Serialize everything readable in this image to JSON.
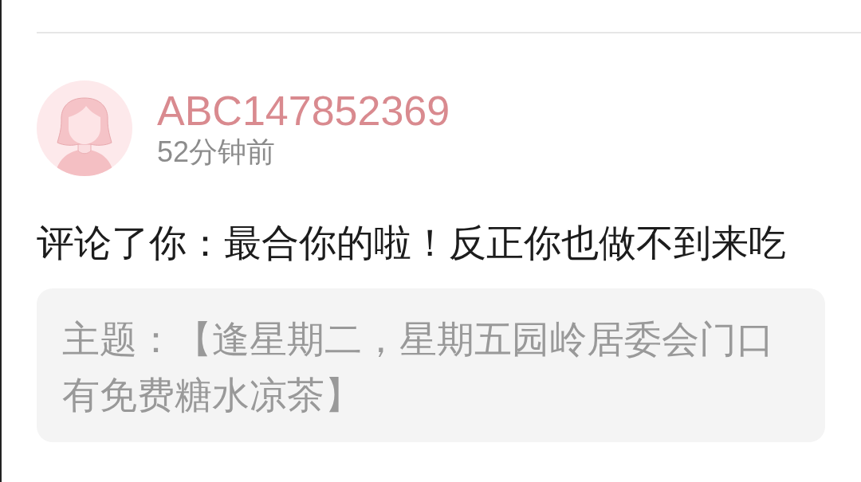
{
  "comment": {
    "user": {
      "name": "ABC147852369",
      "time": "52分钟前"
    },
    "text": "评论了你：最合你的啦！反正你也做不到来吃",
    "subject": "主题：【逢星期二，星期五园岭居委会门口有免费糖水凉茶】"
  }
}
